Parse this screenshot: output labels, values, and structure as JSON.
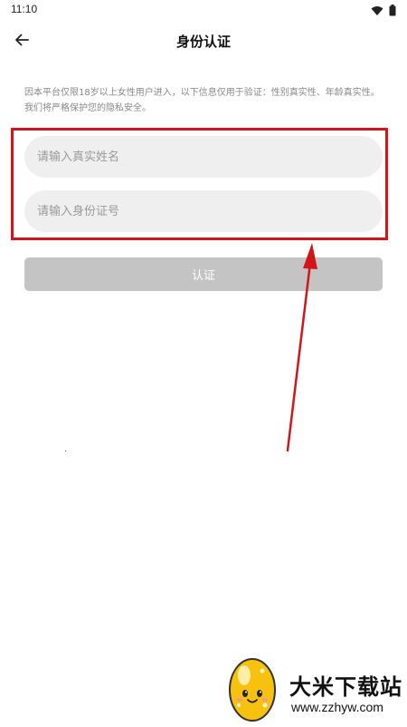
{
  "status_bar": {
    "time": "11:10"
  },
  "header": {
    "title": "身份认证"
  },
  "notice": {
    "text": "因本平台仅限18岁以上女性用户进入，以下信息仅用于验证：性别真实性、年龄真实性。我们将严格保护您的隐私安全。"
  },
  "form": {
    "name_placeholder": "请输入真实姓名",
    "name_value": "",
    "id_placeholder": "请输入身份证号",
    "id_value": "",
    "submit_label": "认证"
  },
  "watermark": {
    "title": "大米下载站",
    "url": "www.zzhyw.com"
  },
  "colors": {
    "highlight_border": "#d0161b",
    "arrow": "#d0161b",
    "input_bg": "#efefef",
    "button_disabled_bg": "#c4c4c4",
    "notice_text": "#888888"
  }
}
